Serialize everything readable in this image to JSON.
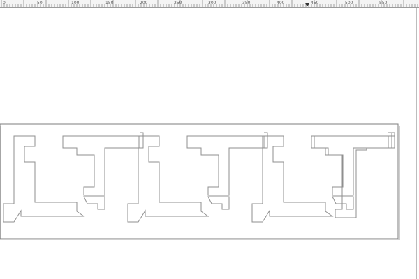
{
  "ruler": {
    "marker_icon": "ruler-marker-icon",
    "labels": [
      "0",
      "50",
      "100",
      "150",
      "200",
      "250",
      "300",
      "350",
      "400",
      "450",
      "500",
      "550"
    ]
  },
  "artwork": {
    "description_icon": "meander-frieze-shape",
    "stroke_color": "#8f8f8f",
    "panel_stroke_color": "#7d7d7d",
    "panel_shadow_color": "#bfbfbf"
  }
}
